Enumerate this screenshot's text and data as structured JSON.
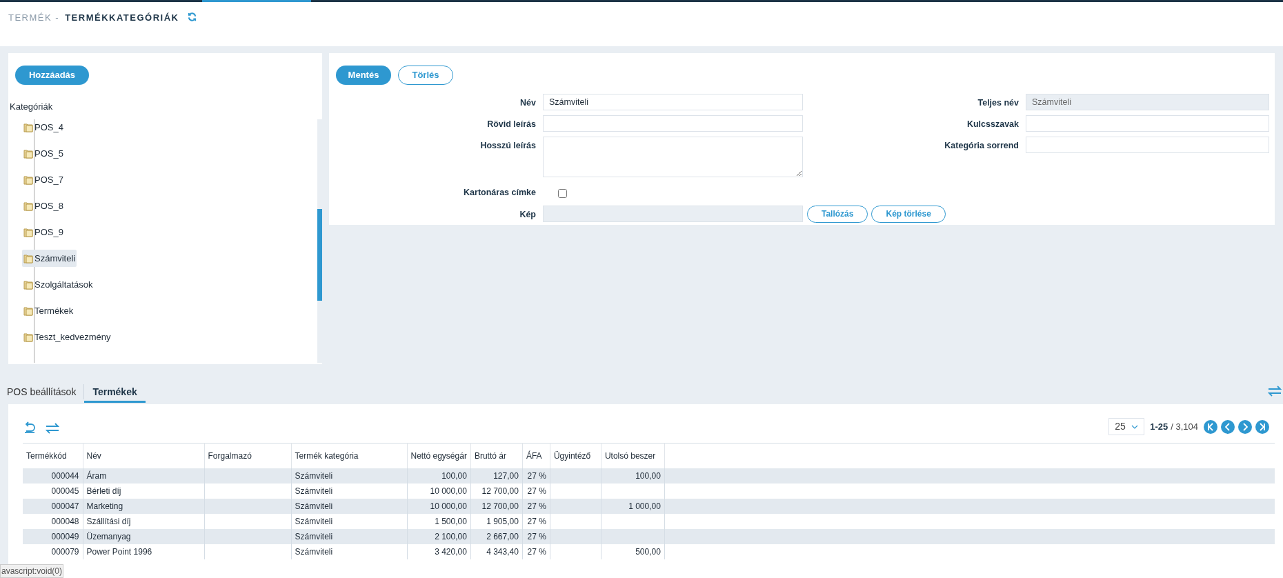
{
  "breadcrumb": {
    "parent": "TERMÉK -",
    "current": "TERMÉKKATEGÓRIÁK"
  },
  "tree": {
    "add_button": "Hozzáadás",
    "root": "Kategóriák",
    "items": [
      {
        "label": "POS_4",
        "selected": false
      },
      {
        "label": "POS_5",
        "selected": false
      },
      {
        "label": "POS_7",
        "selected": false
      },
      {
        "label": "POS_8",
        "selected": false
      },
      {
        "label": "POS_9",
        "selected": false
      },
      {
        "label": "Számviteli",
        "selected": true
      },
      {
        "label": "Szolgáltatások",
        "selected": false
      },
      {
        "label": "Termékek",
        "selected": false
      },
      {
        "label": "Teszt_kedvezmény",
        "selected": false
      }
    ]
  },
  "form": {
    "buttons": [
      {
        "label": "Mentés",
        "kind": "primary"
      },
      {
        "label": "Törlés",
        "kind": "outline"
      }
    ],
    "left_fields": [
      {
        "label": "Név",
        "kind": "text",
        "value": "Számviteli",
        "disabled": false
      },
      {
        "label": "Rövid leírás",
        "kind": "text",
        "disabled": false
      },
      {
        "label": "Hosszú leírás",
        "kind": "textarea",
        "disabled": false
      },
      {
        "label": "Kartonáras címke",
        "kind": "checkbox",
        "checked": false
      },
      {
        "label": "Kép",
        "kind": "file",
        "disabled": true,
        "buttons": [
          "Tallózás",
          "Kép törlése"
        ]
      }
    ],
    "right_fields": [
      {
        "label": "Teljes név",
        "kind": "text",
        "value": "Számviteli",
        "disabled": true
      },
      {
        "label": "Kulcsszavak",
        "kind": "text",
        "disabled": false
      },
      {
        "label": "Kategória sorrend",
        "kind": "text",
        "disabled": false
      }
    ]
  },
  "tabs": [
    {
      "label": "POS beállítások",
      "selected": false
    },
    {
      "label": "Termékek",
      "selected": true
    }
  ],
  "pagination": {
    "page_size": "25",
    "range": "1-25",
    "total": "/ 3,104"
  },
  "table": {
    "columns": [
      "Termékkód",
      "Név",
      "Forgalmazó",
      "Termék kategória",
      "Nettó egységár",
      "Bruttó ár",
      "ÁFA",
      "Ügyintéző",
      "Utolsó beszer"
    ],
    "rows": [
      [
        "000044",
        "Áram",
        "",
        "Számviteli",
        "100,00",
        "127,00",
        "27 %",
        "",
        "100,00"
      ],
      [
        "000045",
        "Bérleti díj",
        "",
        "Számviteli",
        "10 000,00",
        "12 700,00",
        "27 %",
        "",
        ""
      ],
      [
        "000047",
        "Marketing",
        "",
        "Számviteli",
        "10 000,00",
        "12 700,00",
        "27 %",
        "",
        "1 000,00"
      ],
      [
        "000048",
        "Szállítási díj",
        "",
        "Számviteli",
        "1 500,00",
        "1 905,00",
        "27 %",
        "",
        ""
      ],
      [
        "000049",
        "Üzemanyag",
        "",
        "Számviteli",
        "2 100,00",
        "2 667,00",
        "27 %",
        "",
        ""
      ],
      [
        "000079",
        "Power Point 1996",
        "",
        "Számviteli",
        "3 420,00",
        "4 343,40",
        "27 %",
        "",
        "500,00"
      ]
    ]
  },
  "status_url": "avascript:void(0)"
}
